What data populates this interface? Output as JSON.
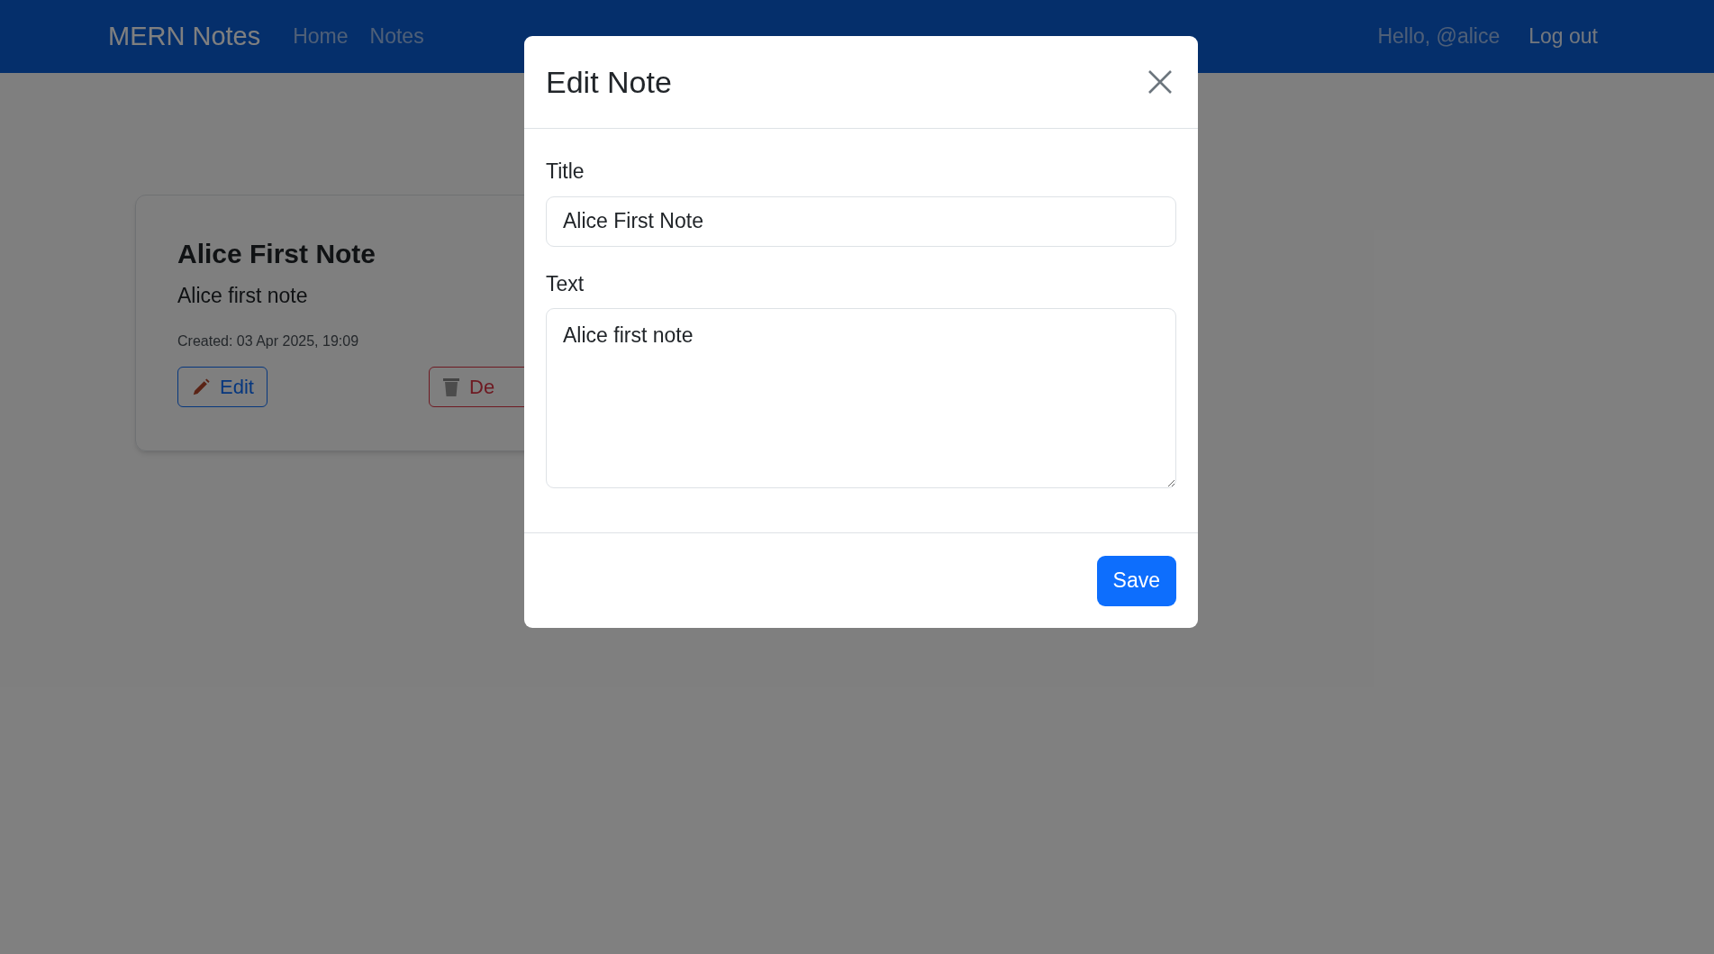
{
  "navbar": {
    "brand": "MERN Notes",
    "links": [
      {
        "label": "Home"
      },
      {
        "label": "Notes"
      }
    ],
    "greeting": "Hello, @alice",
    "logout": "Log out"
  },
  "notes": [
    {
      "title": "Alice First Note",
      "text": "Alice first note",
      "created": "Created: 03 Apr 2025, 19:09",
      "edit_label": "Edit",
      "delete_label": "De"
    }
  ],
  "modal": {
    "title": "Edit Note",
    "fields": [
      {
        "kind": "input",
        "label": "Title",
        "value": "Alice First Note"
      },
      {
        "kind": "textarea",
        "label": "Text",
        "value": "Alice first note"
      }
    ],
    "save": "Save"
  }
}
